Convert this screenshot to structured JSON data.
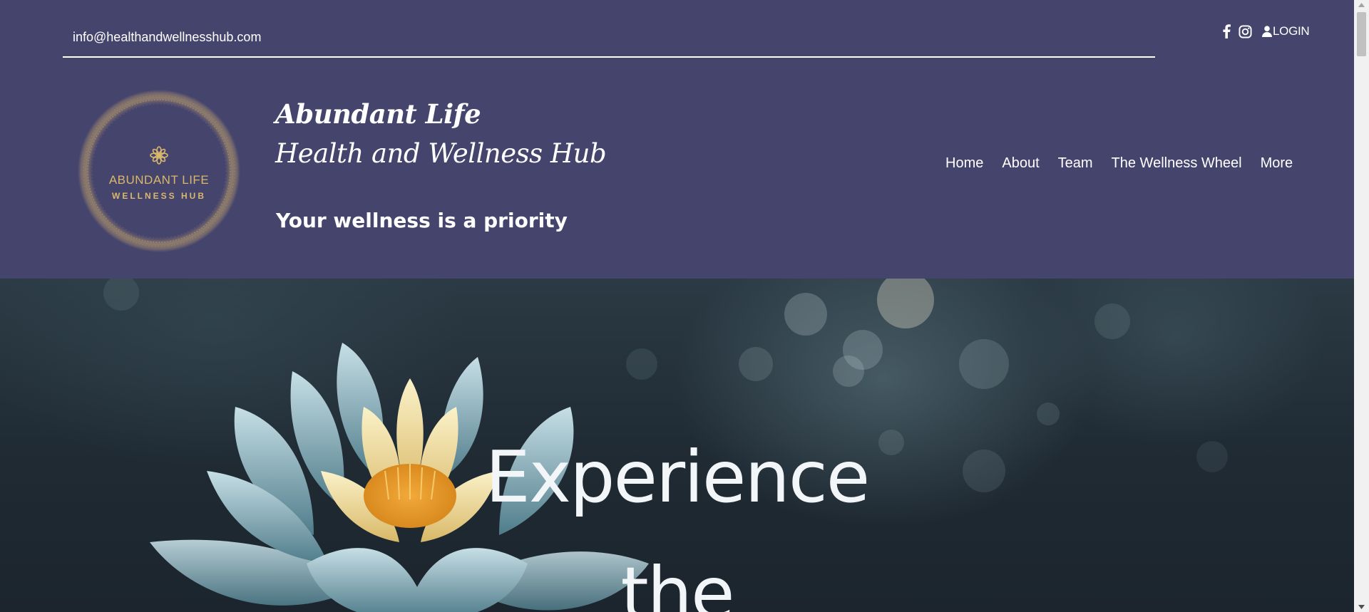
{
  "header": {
    "email": "info@healthandwellnesshub.com",
    "login_label": "LOGIN",
    "title_line_1": "Abundant Life",
    "title_line_2": "Health and Wellness Hub",
    "tagline": "Your wellness is a priority",
    "logo": {
      "line_1": "ABUNDANT LIFE",
      "line_2": "WELLNESS HUB"
    },
    "social_icons": [
      "facebook-icon",
      "instagram-icon"
    ],
    "nav": [
      "Home",
      "About",
      "Team",
      "The Wellness Wheel",
      "More"
    ]
  },
  "hero": {
    "line_1": "Experience",
    "line_2": "the"
  },
  "colors": {
    "header_bg": "#45446d",
    "logo_gold": "#c9a96a",
    "hero_dark": "#1f2a33",
    "text": "#ffffff"
  }
}
